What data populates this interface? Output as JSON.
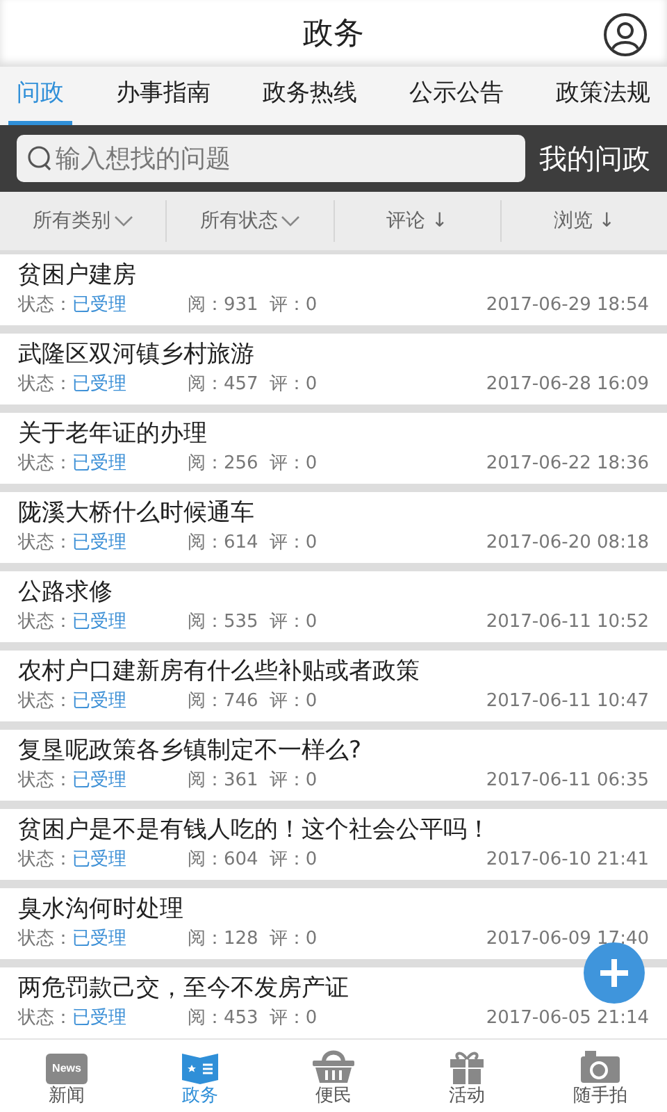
{
  "header": {
    "title": "政务"
  },
  "tabs": [
    {
      "label": "问政",
      "selected": true
    },
    {
      "label": "办事指南",
      "selected": false
    },
    {
      "label": "政务热线",
      "selected": false
    },
    {
      "label": "公示公告",
      "selected": false
    },
    {
      "label": "政策法规",
      "selected": false
    }
  ],
  "search": {
    "placeholder": "输入想找的问题",
    "my_button": "我的问政"
  },
  "filters": [
    {
      "label": "所有类别",
      "kind": "dropdown"
    },
    {
      "label": "所有状态",
      "kind": "dropdown"
    },
    {
      "label": "评论 ↓",
      "kind": "sort"
    },
    {
      "label": "浏览 ↓",
      "kind": "sort"
    }
  ],
  "questions": [
    {
      "title": "贫困户建房",
      "status_label": "状态：",
      "status": "已受理",
      "views": "阅：931",
      "comments": "评：0",
      "time": "2017-06-29 18:54"
    },
    {
      "title": "武隆区双河镇乡村旅游",
      "status_label": "状态：",
      "status": "已受理",
      "views": "阅：457",
      "comments": "评：0",
      "time": "2017-06-28 16:09"
    },
    {
      "title": "关于老年证的办理",
      "status_label": "状态：",
      "status": "已受理",
      "views": "阅：256",
      "comments": "评：0",
      "time": "2017-06-22 18:36"
    },
    {
      "title": "陇溪大桥什么时候通车",
      "status_label": "状态：",
      "status": "已受理",
      "views": "阅：614",
      "comments": "评：0",
      "time": "2017-06-20 08:18"
    },
    {
      "title": "公路求修",
      "status_label": "状态：",
      "status": "已受理",
      "views": "阅：535",
      "comments": "评：0",
      "time": "2017-06-11 10:52"
    },
    {
      "title": "农村户口建新房有什么些补贴或者政策",
      "status_label": "状态：",
      "status": "已受理",
      "views": "阅：746",
      "comments": "评：0",
      "time": "2017-06-11 10:47"
    },
    {
      "title": "复垦呢政策各乡镇制定不一样么?",
      "status_label": "状态：",
      "status": "已受理",
      "views": "阅：361",
      "comments": "评：0",
      "time": "2017-06-11 06:35"
    },
    {
      "title": "贫困户是不是有钱人吃的！这个社会公平吗！",
      "status_label": "状态：",
      "status": "已受理",
      "views": "阅：604",
      "comments": "评：0",
      "time": "2017-06-10 21:41"
    },
    {
      "title": "臭水沟何时处理",
      "status_label": "状态：",
      "status": "已受理",
      "views": "阅：128",
      "comments": "评：0",
      "time": "2017-06-09 17:40"
    },
    {
      "title": "两危罚款己交，至今不发房产证",
      "status_label": "状态：",
      "status": "已受理",
      "views": "阅：453",
      "comments": "评：0",
      "time": "2017-06-05 21:14"
    }
  ],
  "bottom_nav": [
    {
      "label": "新闻",
      "icon_label": "News",
      "selected": false
    },
    {
      "label": "政务",
      "selected": true
    },
    {
      "label": "便民",
      "selected": false
    },
    {
      "label": "活动",
      "selected": false
    },
    {
      "label": "随手拍",
      "selected": false
    }
  ]
}
